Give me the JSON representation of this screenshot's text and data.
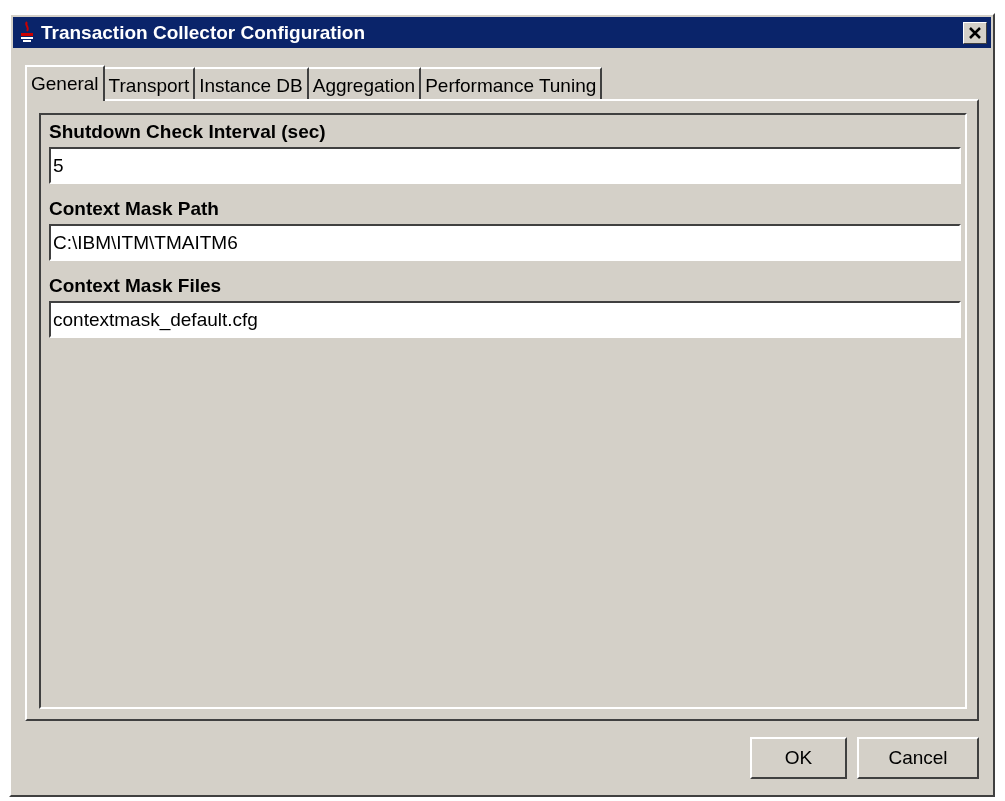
{
  "window": {
    "title": "Transaction Collector Configuration"
  },
  "tabs": [
    {
      "label": "General",
      "selected": true
    },
    {
      "label": "Transport",
      "selected": false
    },
    {
      "label": "Instance DB",
      "selected": false
    },
    {
      "label": "Aggregation",
      "selected": false
    },
    {
      "label": "Performance Tuning",
      "selected": false
    }
  ],
  "fields": [
    {
      "label": "Shutdown Check Interval (sec)",
      "value": "5"
    },
    {
      "label": "Context Mask Path",
      "value": "C:\\IBM\\ITM\\TMAITM6"
    },
    {
      "label": "Context Mask Files",
      "value": "contextmask_default.cfg"
    }
  ],
  "buttons": [
    "OK",
    "Cancel"
  ]
}
